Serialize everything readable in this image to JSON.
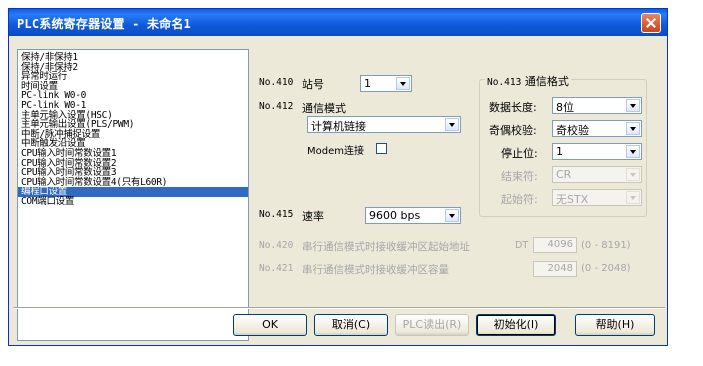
{
  "window": {
    "title": "PLC系统寄存器设置 - 未命名1"
  },
  "list": {
    "items": [
      "保持/非保持1",
      "保持/非保持2",
      "异常时运行",
      "时间设置",
      "PC-link W0-0",
      "PC-link W0-1",
      "主单元输入设置(HSC)",
      "主单元输出设置(PLS/PWM)",
      "中断/脉冲捕捉设置",
      "中断触发沿设置",
      "CPU输入时间常数设置1",
      "CPU输入时间常数设置2",
      "CPU输入时间常数设置3",
      "CPU输入时间常数设置4(只有L60R)",
      "编程口设置",
      "COM端口设置"
    ],
    "selected_index": 14
  },
  "settings": {
    "station": {
      "no": "No.410",
      "label": "站号",
      "value": "1"
    },
    "comm_mode": {
      "no": "No.412",
      "label": "通信模式",
      "value": "计算机链接"
    },
    "modem": {
      "label": "Modem连接",
      "checked": false
    },
    "speed": {
      "no": "No.415",
      "label": "速率",
      "value": "9600 bps"
    },
    "buffer_start": {
      "no": "No.420",
      "label": "串行通信模式时接收缓冲区起始地址",
      "prefix": "DT",
      "value": "4096",
      "range": "(0 - 8191)"
    },
    "buffer_size": {
      "no": "No.421",
      "label": "串行通信模式时接收缓冲区容量",
      "value": "2048",
      "range": "(0 - 2048)"
    }
  },
  "format": {
    "no": "No.413",
    "title": "通信格式",
    "data_length": {
      "label": "数据长度:",
      "value": "8位"
    },
    "parity": {
      "label": "奇偶校验:",
      "value": "奇校验"
    },
    "stop_bit": {
      "label": "停止位:",
      "value": "1"
    },
    "end_char": {
      "label": "结束符:",
      "value": "CR"
    },
    "start_char": {
      "label": "起始符:",
      "value": "无STX"
    }
  },
  "buttons": {
    "ok": "OK",
    "cancel": "取消(C)",
    "plc_read": "PLC读出(R)",
    "init": "初始化(I)",
    "help": "帮助(H)"
  }
}
